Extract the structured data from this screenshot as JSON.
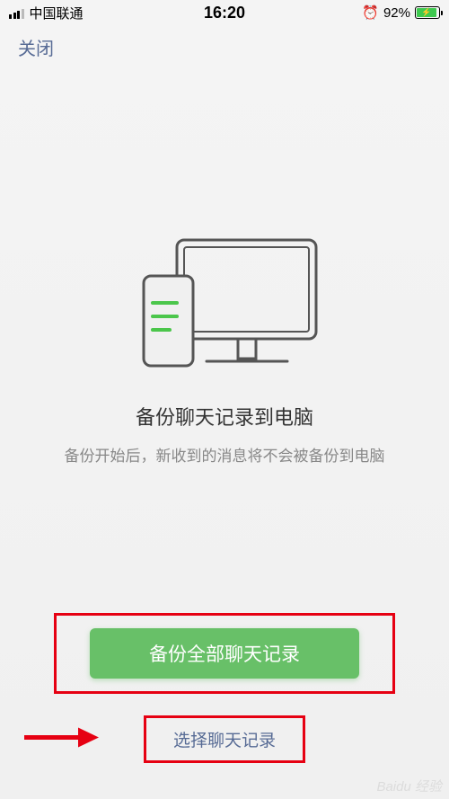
{
  "status": {
    "carrier": "中国联通",
    "time": "16:20",
    "battery_pct": "92%"
  },
  "nav": {
    "close": "关闭"
  },
  "main": {
    "title": "备份聊天记录到电脑",
    "subtitle": "备份开始后，新收到的消息将不会被备份到电脑",
    "primary_button": "备份全部聊天记录",
    "secondary_link": "选择聊天记录"
  },
  "watermark": "Baidu 经验"
}
